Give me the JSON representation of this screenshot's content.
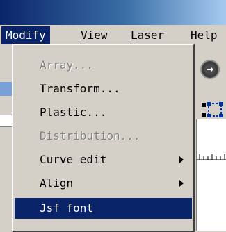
{
  "menubar": {
    "items": [
      {
        "label": "Modify",
        "accel": "M",
        "rest": "odify"
      },
      {
        "label": "View",
        "accel": "V",
        "rest": "iew"
      },
      {
        "label": "Laser",
        "accel": "L",
        "rest": "aser"
      },
      {
        "label": "Help",
        "accel": "",
        "rest": "Help"
      }
    ]
  },
  "dropdown": {
    "items": [
      {
        "label": "Array...",
        "enabled": false,
        "submenu": false
      },
      {
        "label": "Transform...",
        "enabled": true,
        "submenu": false
      },
      {
        "label": "Plastic...",
        "enabled": true,
        "submenu": false
      },
      {
        "label": "Distribution...",
        "enabled": false,
        "submenu": false
      },
      {
        "label": "Curve edit",
        "enabled": true,
        "submenu": true
      },
      {
        "label": "Align",
        "enabled": true,
        "submenu": true
      },
      {
        "label": "Jsf font",
        "enabled": true,
        "submenu": false,
        "highlighted": true
      }
    ]
  },
  "colors": {
    "menu_highlight": "#0a246a",
    "menu_background": "#d4d0c8",
    "disabled_text": "#808080"
  }
}
